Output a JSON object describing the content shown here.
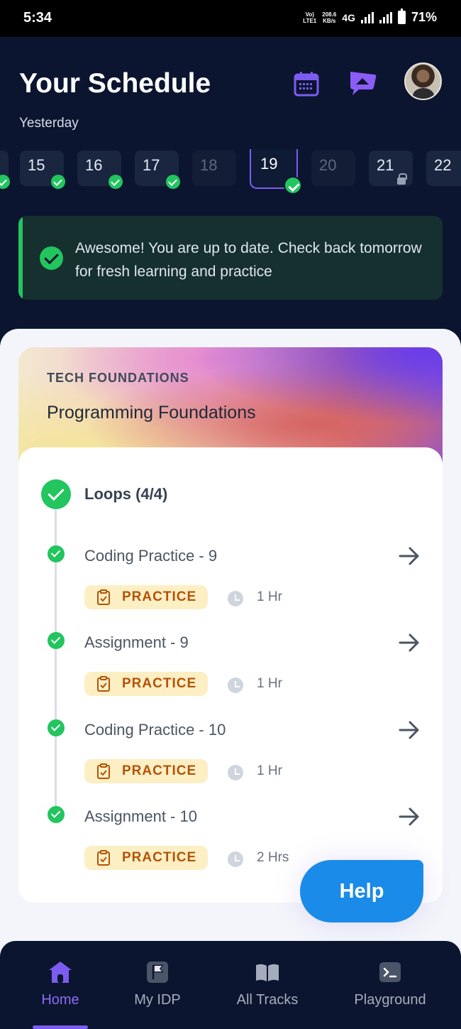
{
  "status_bar": {
    "time": "5:34",
    "network_top": "Vo)",
    "network_bottom": "LTE1",
    "speed_value": "208.6",
    "speed_unit": "KB/s",
    "network_type": "4G",
    "battery": "71%"
  },
  "header": {
    "title": "Your Schedule",
    "subtitle": "Yesterday",
    "calendar_icon": "calendar-icon",
    "message_icon": "chat-bubble-icon"
  },
  "dates": [
    {
      "label": "15",
      "state": "done"
    },
    {
      "label": "16",
      "state": "done"
    },
    {
      "label": "17",
      "state": "done"
    },
    {
      "label": "18",
      "state": "empty"
    },
    {
      "label": "19",
      "state": "selected-done"
    },
    {
      "label": "20",
      "state": "empty"
    },
    {
      "label": "21",
      "state": "locked"
    },
    {
      "label": "22",
      "state": "upcoming"
    }
  ],
  "banner": {
    "text": "Awesome! You are up to date. Check back tomorrow for fresh learning and practice"
  },
  "course": {
    "category": "TECH FOUNDATIONS",
    "name": "Programming Foundations",
    "topic": "Loops (4/4)",
    "items": [
      {
        "label": "Coding Practice - 9",
        "type": "PRACTICE",
        "duration": "1 Hr"
      },
      {
        "label": "Assignment - 9",
        "type": "PRACTICE",
        "duration": "1 Hr"
      },
      {
        "label": "Coding Practice - 10",
        "type": "PRACTICE",
        "duration": "1 Hr"
      },
      {
        "label": "Assignment - 10",
        "type": "PRACTICE",
        "duration": "2 Hrs"
      }
    ]
  },
  "help": {
    "label": "Help"
  },
  "nav": [
    {
      "label": "Home",
      "icon": "home-icon",
      "active": true
    },
    {
      "label": "My IDP",
      "icon": "flag-icon",
      "active": false
    },
    {
      "label": "All Tracks",
      "icon": "book-icon",
      "active": false
    },
    {
      "label": "Playground",
      "icon": "terminal-icon",
      "active": false
    }
  ],
  "colors": {
    "background": "#0b1530",
    "accent": "#7c5cf0",
    "success": "#22c55e",
    "help": "#1a8be8",
    "pill": "#fdefc4"
  }
}
